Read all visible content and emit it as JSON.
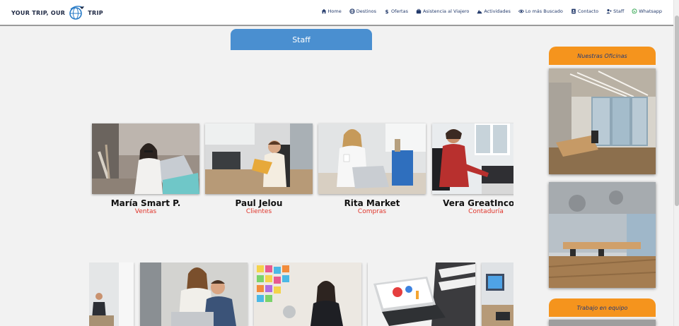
{
  "brand": {
    "left_text": "YOUR TRIP, OUR",
    "right_text": "TRIP",
    "logo_icon": "globe-airplane-icon"
  },
  "nav": {
    "items": [
      {
        "label": "Home",
        "icon": "home-icon"
      },
      {
        "label": "Destinos",
        "icon": "globe-icon"
      },
      {
        "label": "Ofertas",
        "icon": "dollar-icon"
      },
      {
        "label": "Asistencia al Viajero",
        "icon": "briefcase-icon"
      },
      {
        "label": "Actividades",
        "icon": "mountain-icon"
      },
      {
        "label": "Lo más Buscado",
        "icon": "eye-icon"
      },
      {
        "label": "Contacto",
        "icon": "contact-card-icon"
      },
      {
        "label": "Staff",
        "icon": "user-plus-icon"
      },
      {
        "label": "Whatsapp",
        "icon": "whatsapp-icon"
      }
    ]
  },
  "section_title": "Staff",
  "staff": [
    {
      "name": "María Smart P.",
      "role": "Ventas"
    },
    {
      "name": "Paul Jelou",
      "role": "Clientes"
    },
    {
      "name": "Rita Market",
      "role": "Compras"
    },
    {
      "name": "Vera GreatIncome",
      "role": "Contaduría"
    }
  ],
  "sidebar": {
    "offices_title": "Nuestras Oficinas",
    "team_title": "Trabajo en equipo"
  },
  "colors": {
    "accent_blue": "#4a8fd0",
    "accent_orange": "#f5941d",
    "role_red": "#e0342a",
    "nav_text": "#233a6b"
  }
}
